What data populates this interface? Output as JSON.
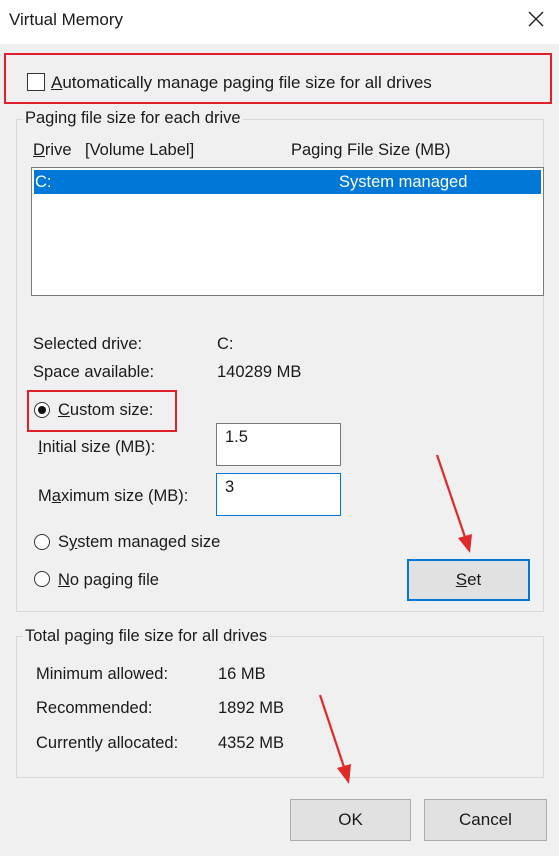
{
  "window": {
    "title": "Virtual Memory"
  },
  "auto_manage": {
    "label": "Automatically manage paging file size for all drives",
    "checked": false
  },
  "drives_group": {
    "title": "Paging file size for each drive",
    "col_drive": "Drive",
    "col_volume": "[Volume Label]",
    "col_size": "Paging File Size (MB)",
    "rows": [
      {
        "drive": "C:",
        "size": "System managed"
      }
    ]
  },
  "selected": {
    "drive_label": "Selected drive:",
    "drive_value": "C:",
    "space_label": "Space available:",
    "space_value": "140289 MB"
  },
  "custom_size": {
    "label": "Custom size:",
    "selected": true,
    "initial_label": "Initial size (MB):",
    "initial_value": "1.5",
    "max_label": "Maximum size (MB):",
    "max_value": "3"
  },
  "system_managed": {
    "label": "System managed size",
    "selected": false
  },
  "no_paging": {
    "label": "No paging file",
    "selected": false
  },
  "set_button": "Set",
  "totals_group": {
    "title": "Total paging file size for all drives",
    "min_label": "Minimum allowed:",
    "min_value": "16 MB",
    "rec_label": "Recommended:",
    "rec_value": "1892 MB",
    "cur_label": "Currently allocated:",
    "cur_value": "4352 MB"
  },
  "footer": {
    "ok": "OK",
    "cancel": "Cancel"
  },
  "colors": {
    "highlight": "#e0202a",
    "selection": "#0078d7",
    "annotation_arrow": "#e02a2a"
  }
}
